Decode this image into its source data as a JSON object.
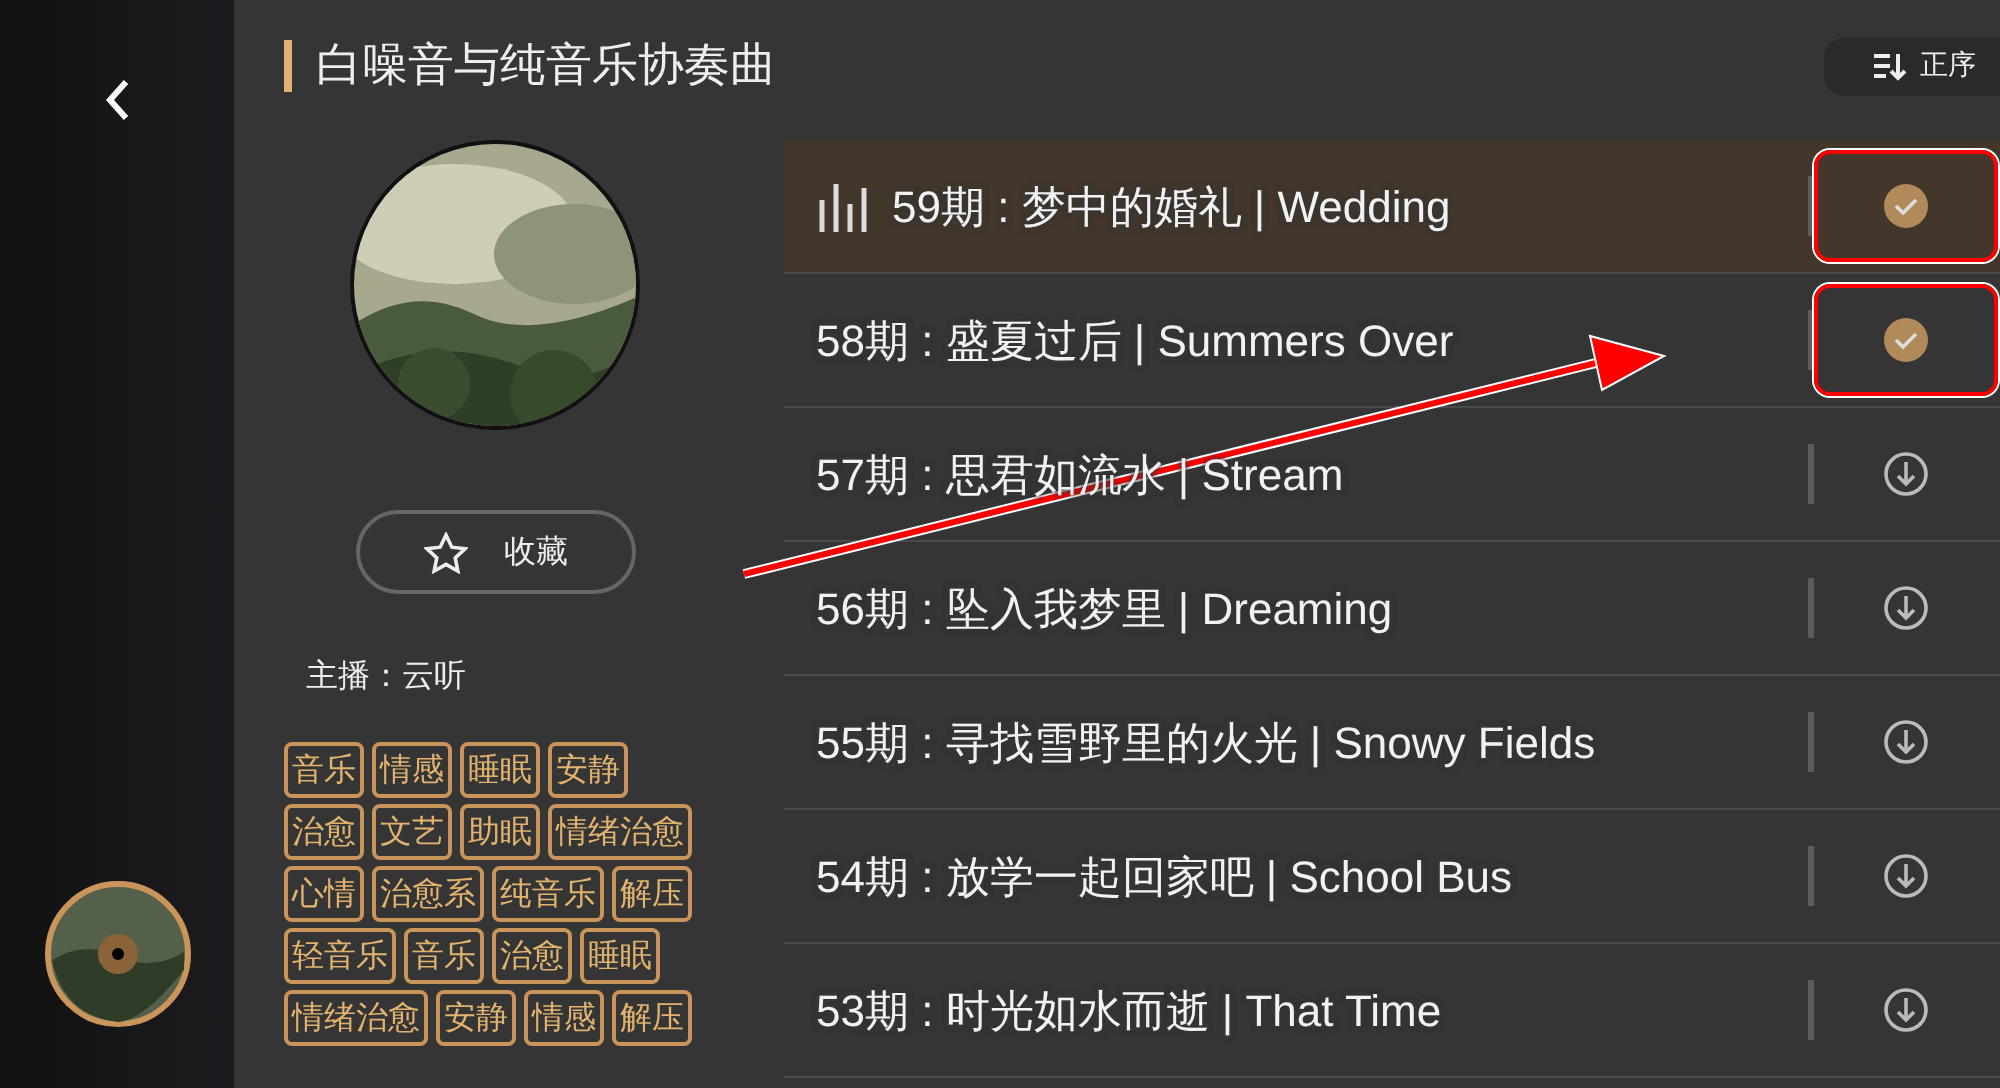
{
  "header": {
    "title": "白噪音与纯音乐协奏曲",
    "sort_label": "正序"
  },
  "album": {
    "favorite_label": "收藏",
    "host": "主播：云听",
    "tags": [
      "音乐",
      "情感",
      "睡眠",
      "安静",
      "治愈",
      "文艺",
      "助眠",
      "情绪治愈",
      "心情",
      "治愈系",
      "纯音乐",
      "解压",
      "轻音乐",
      "音乐",
      "治愈",
      "睡眠",
      "情绪治愈",
      "安静",
      "情感",
      "解压"
    ]
  },
  "episodes": [
    {
      "title": "59期 : 梦中的婚礼 | Wedding",
      "selected": true,
      "downloaded": true,
      "highlighted": true
    },
    {
      "title": "58期 : 盛夏过后 | Summers Over",
      "selected": false,
      "downloaded": true,
      "highlighted": true
    },
    {
      "title": "57期 : 思君如流水 | Stream",
      "selected": false,
      "downloaded": false,
      "highlighted": false
    },
    {
      "title": "56期 : 坠入我梦里 | Dreaming",
      "selected": false,
      "downloaded": false,
      "highlighted": false
    },
    {
      "title": "55期 : 寻找雪野里的火光 | Snowy Fields",
      "selected": false,
      "downloaded": false,
      "highlighted": false
    },
    {
      "title": "54期 : 放学一起回家吧 | School Bus",
      "selected": false,
      "downloaded": false,
      "highlighted": false
    },
    {
      "title": "53期 : 时光如水而逝 | That Time",
      "selected": false,
      "downloaded": false,
      "highlighted": false
    }
  ],
  "annotation_arrow": true
}
